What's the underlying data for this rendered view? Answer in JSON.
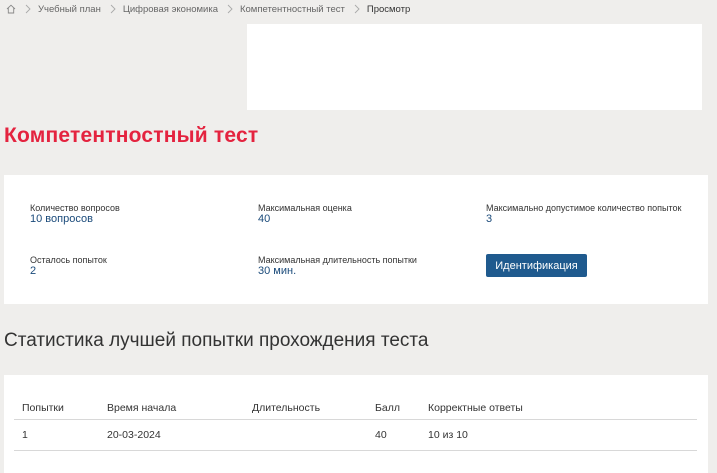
{
  "breadcrumb": {
    "items": [
      "Учебный план",
      "Цифровая экономика",
      "Компетентностный тест"
    ],
    "current": "Просмотр"
  },
  "page": {
    "title": "Компетентностный тест"
  },
  "info": {
    "questions_label": "Количество вопросов",
    "questions_value": "10 вопросов",
    "max_score_label": "Максимальная оценка",
    "max_score_value": "40",
    "max_attempts_label": "Максимально допустимое количество попыток",
    "max_attempts_value": "3",
    "remaining_label": "Осталось попыток",
    "remaining_value": "2",
    "max_duration_label": "Максимальная длительность попытки",
    "max_duration_value": "30 мин.",
    "ident_button_label": "Идентификация"
  },
  "stats": {
    "title": "Статистика лучшей попытки прохождения теста",
    "columns": [
      "Попытки",
      "Время начала",
      "Длительность",
      "Балл",
      "Корректные ответы"
    ],
    "rows": [
      [
        "1",
        "20-03-2024",
        "",
        "40",
        "10 из 10"
      ]
    ]
  },
  "colors": {
    "accent_title": "#e4233f",
    "button": "#1f5a8e",
    "value_text": "#1a4a7a"
  },
  "icons": {
    "home": "home-icon",
    "separator": "chevron-right-icon"
  }
}
